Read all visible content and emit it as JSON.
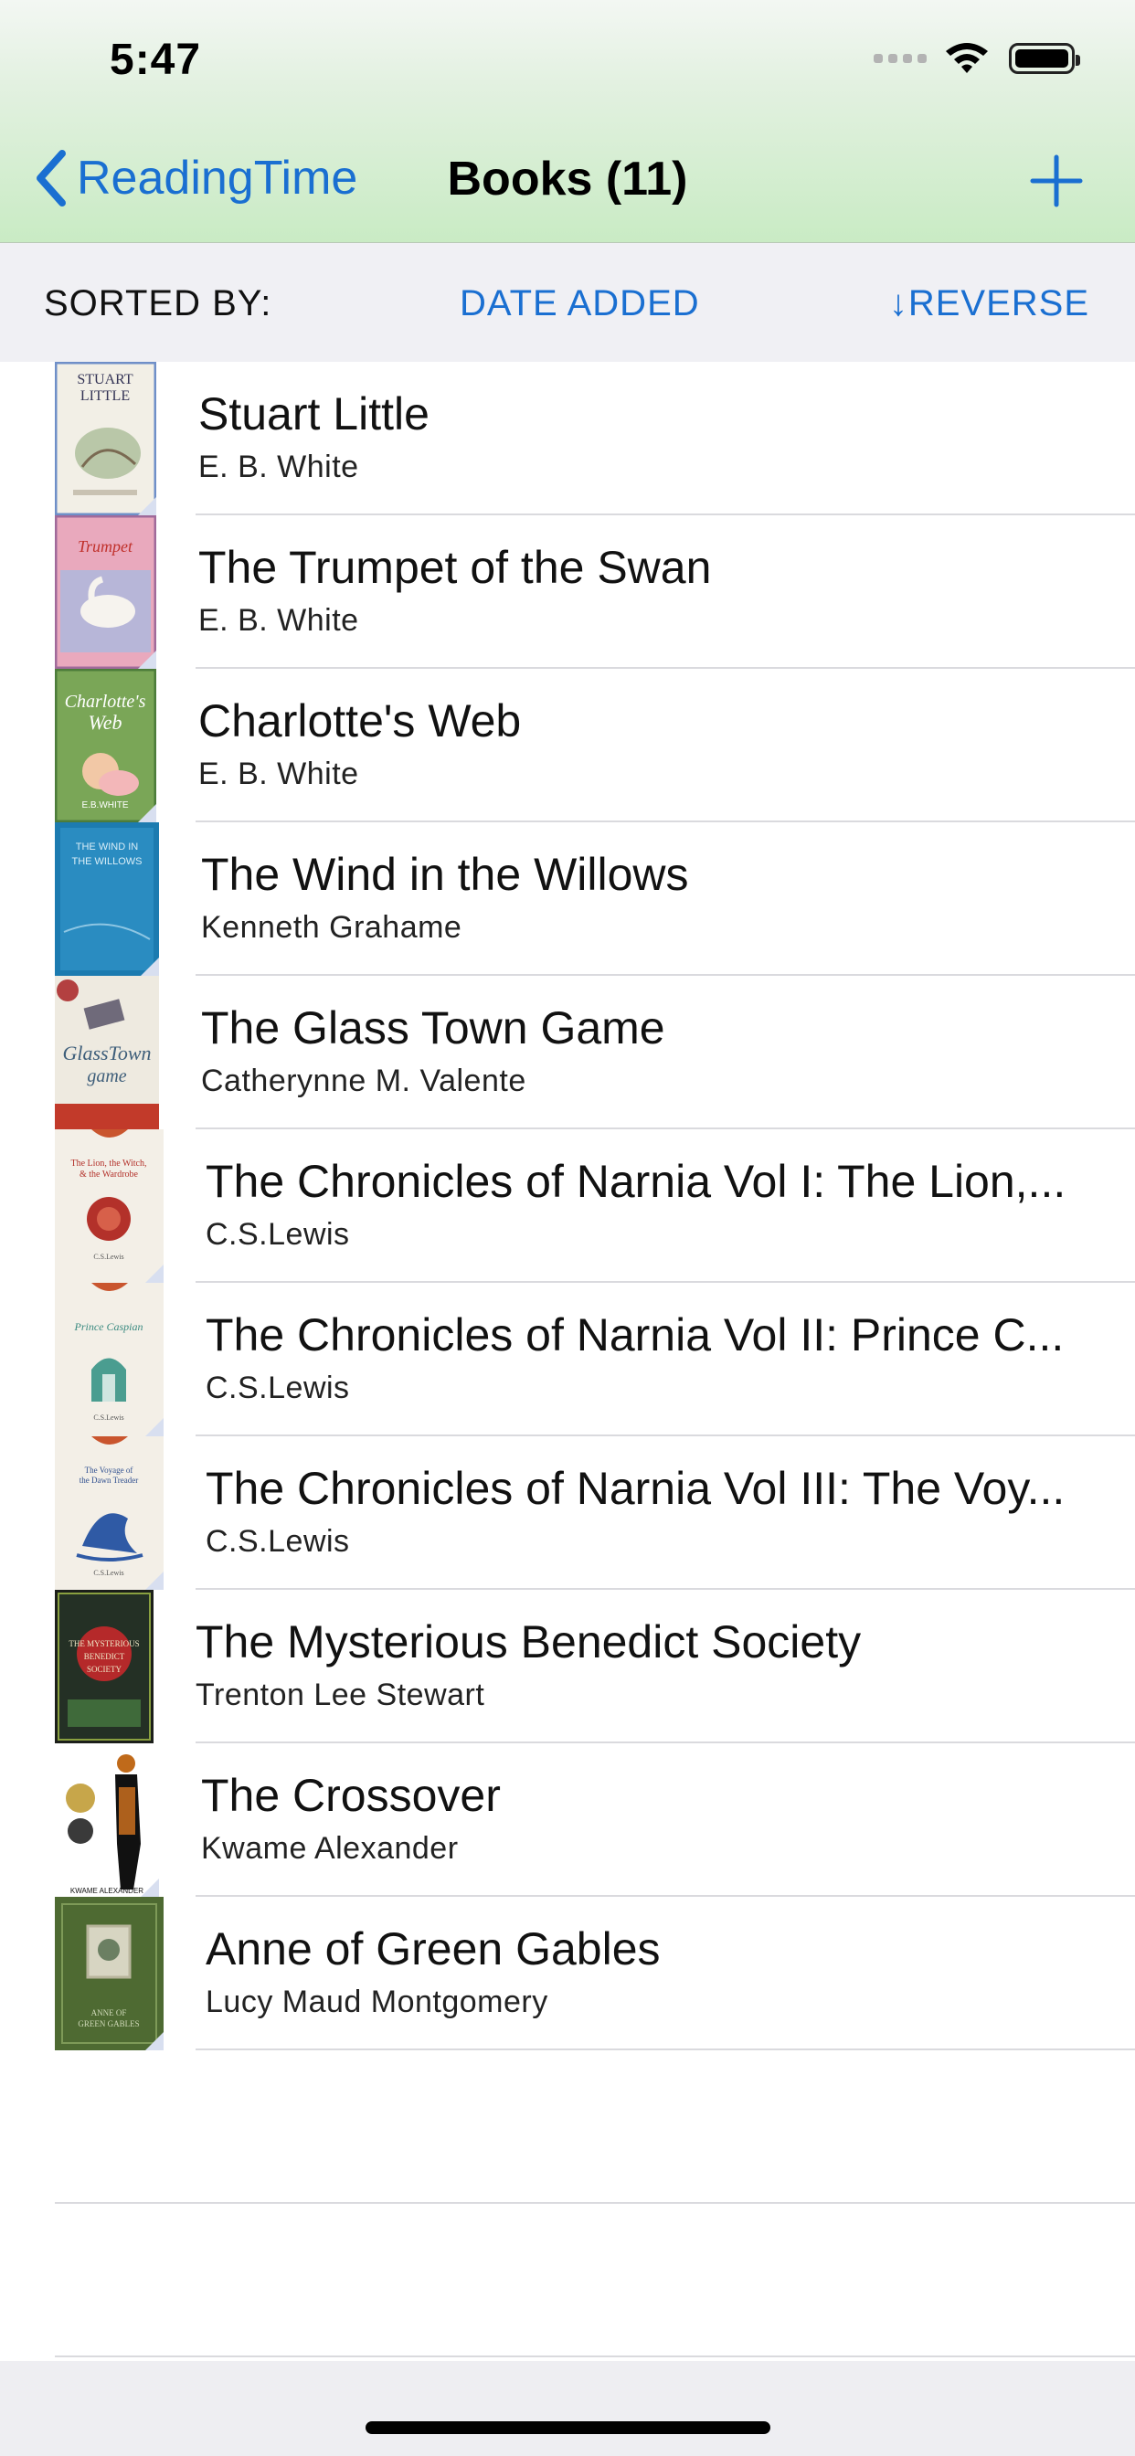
{
  "status": {
    "time": "5:47"
  },
  "nav": {
    "back_label": "ReadingTime",
    "title": "Books (11)"
  },
  "sort": {
    "label": "SORTED BY:",
    "value": "DATE ADDED",
    "reverse": "↓REVERSE"
  },
  "books": [
    {
      "title": "Stuart Little",
      "author": "E. B. White"
    },
    {
      "title": "The Trumpet of the Swan",
      "author": "E. B. White"
    },
    {
      "title": "Charlotte's Web",
      "author": "E. B. White"
    },
    {
      "title": "The Wind in the Willows",
      "author": "Kenneth Grahame"
    },
    {
      "title": "The Glass Town Game",
      "author": "Catherynne M. Valente"
    },
    {
      "title": "The Chronicles of Narnia Vol I: The Lion,...",
      "author": "C.S.Lewis"
    },
    {
      "title": "The Chronicles of Narnia Vol II: Prince C...",
      "author": "C.S.Lewis"
    },
    {
      "title": "The Chronicles of Narnia Vol III: The Voy...",
      "author": "C.S.Lewis"
    },
    {
      "title": "The Mysterious Benedict Society",
      "author": "Trenton Lee Stewart"
    },
    {
      "title": "The Crossover",
      "author": "Kwame Alexander"
    },
    {
      "title": "Anne of Green Gables",
      "author": "Lucy Maud Montgomery"
    }
  ],
  "colors": {
    "accent": "#1a6fd1",
    "header_green": "#c9ebc4",
    "sortbar_bg": "#f0f0f4"
  }
}
